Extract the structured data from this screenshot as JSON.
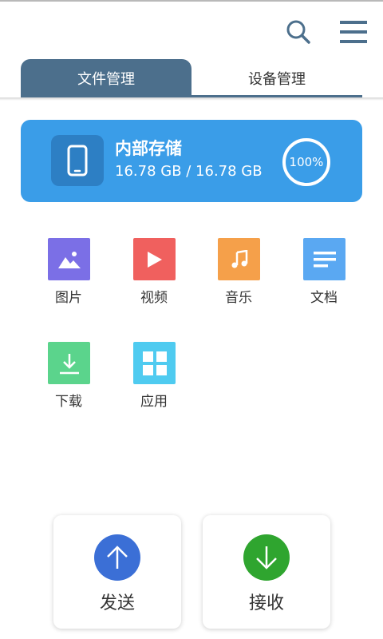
{
  "header": {
    "search_icon": "search-icon",
    "menu_icon": "menu-icon"
  },
  "tabs": [
    {
      "label": "文件管理",
      "active": true
    },
    {
      "label": "设备管理",
      "active": false
    }
  ],
  "storage": {
    "title": "内部存储",
    "size": "16.78 GB / 16.78 GB",
    "percent": "100%",
    "icon": "phone-icon"
  },
  "categories": [
    {
      "label": "图片",
      "icon": "image-icon",
      "color": "#7b6fe6"
    },
    {
      "label": "视频",
      "icon": "play-icon",
      "color": "#f0605e"
    },
    {
      "label": "音乐",
      "icon": "music-icon",
      "color": "#f5a04a"
    },
    {
      "label": "文档",
      "icon": "document-icon",
      "color": "#5aa8f2"
    },
    {
      "label": "下载",
      "icon": "download-icon",
      "color": "#5bd48c"
    },
    {
      "label": "应用",
      "icon": "apps-icon",
      "color": "#4fcbf0"
    }
  ],
  "actions": {
    "send": {
      "label": "发送",
      "icon": "arrow-up-icon",
      "color": "#3b6fd6"
    },
    "receive": {
      "label": "接收",
      "icon": "arrow-down-icon",
      "color": "#2fa52f"
    }
  },
  "colors": {
    "accent": "#4c6f8c",
    "storage_card": "#3a9de8"
  }
}
